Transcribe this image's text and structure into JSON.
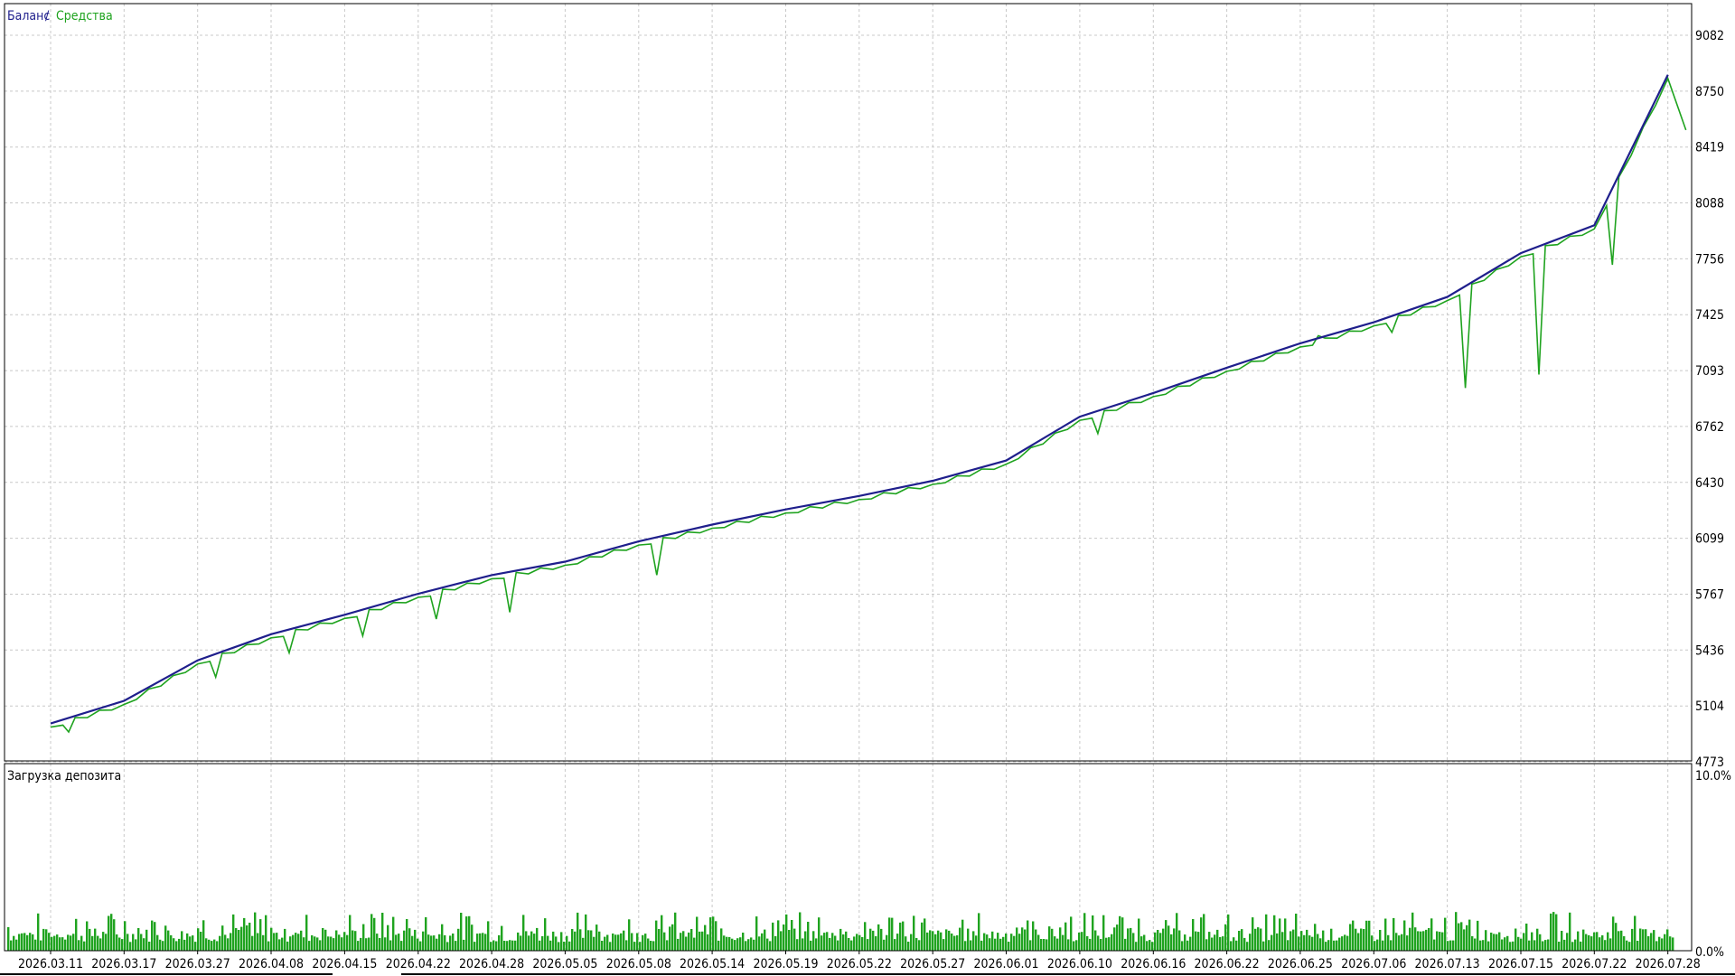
{
  "colors": {
    "background": "#ffffff",
    "grid": "#c8c8c8",
    "frame": "#000000",
    "balance": "#1f1f8c",
    "equity": "#1fa31f",
    "load": "#1fa31f"
  },
  "legend": {
    "balance": "Баланс",
    "separator": "/",
    "equity": "Средства"
  },
  "load_panel": {
    "label": "Загрузка депозита"
  },
  "chart_data": [
    {
      "type": "line",
      "title": "",
      "series": [
        {
          "name": "Баланс",
          "color": "#1f1f8c"
        },
        {
          "name": "Средства",
          "color": "#1fa31f"
        }
      ],
      "x": [
        "2026.03.11",
        "2026.03.17",
        "2026.03.27",
        "2026.04.08",
        "2026.04.15",
        "2026.04.22",
        "2026.04.28",
        "2026.05.05",
        "2026.05.08",
        "2026.05.14",
        "2026.05.19",
        "2026.05.22",
        "2026.05.27",
        "2026.06.01",
        "2026.06.10",
        "2026.06.16",
        "2026.06.22",
        "2026.06.25",
        "2026.07.06",
        "2026.07.13",
        "2026.07.15",
        "2026.07.22",
        "2026.07.28"
      ],
      "balance_points": [
        [
          "2026.03.11",
          5000
        ],
        [
          "2026.03.17",
          5135
        ],
        [
          "2026.03.27",
          5375
        ],
        [
          "2026.04.08",
          5530
        ],
        [
          "2026.04.15",
          5645
        ],
        [
          "2026.04.22",
          5770
        ],
        [
          "2026.04.28",
          5880
        ],
        [
          "2026.05.05",
          5960
        ],
        [
          "2026.05.08",
          6080
        ],
        [
          "2026.05.14",
          6180
        ],
        [
          "2026.05.19",
          6270
        ],
        [
          "2026.05.22",
          6350
        ],
        [
          "2026.05.27",
          6440
        ],
        [
          "2026.06.01",
          6560
        ],
        [
          "2026.06.10",
          6820
        ],
        [
          "2026.06.16",
          6960
        ],
        [
          "2026.06.22",
          7110
        ],
        [
          "2026.06.25",
          7255
        ],
        [
          "2026.07.06",
          7380
        ],
        [
          "2026.07.13",
          7530
        ],
        [
          "2026.07.15",
          7790
        ],
        [
          "2026.07.22",
          7955
        ],
        [
          "2026.07.28",
          8847
        ]
      ],
      "equity_drawdowns": [
        [
          "2026.03.11",
          4950
        ],
        [
          "2026.03.27",
          5275
        ],
        [
          "2026.04.08",
          5420
        ],
        [
          "2026.04.15",
          5520
        ],
        [
          "2026.04.22",
          5620
        ],
        [
          "2026.04.28",
          5660
        ],
        [
          "2026.05.08",
          5880
        ],
        [
          "2026.05.14",
          6180
        ],
        [
          "2026.06.10",
          6720
        ],
        [
          "2026.06.25",
          7300
        ],
        [
          "2026.07.06",
          7320
        ],
        [
          "2026.07.13",
          6990
        ],
        [
          "2026.07.15",
          7070
        ],
        [
          "2026.07.22",
          7720
        ],
        [
          "2026.07.28",
          8520
        ]
      ],
      "y_ticks": [
        9082,
        8750,
        8419,
        8088,
        7756,
        7425,
        7093,
        6762,
        6430,
        6099,
        5767,
        5436,
        5104,
        4773
      ],
      "ylim": [
        4773,
        9082
      ],
      "grid": true
    },
    {
      "type": "bar",
      "title": "Загрузка депозита",
      "series": [
        {
          "name": "Загрузка депозита",
          "color": "#1fa31f"
        }
      ],
      "x_range": [
        "2026.03.11",
        "2026.07.28"
      ],
      "typical_range": [
        0.3,
        2.1
      ],
      "y_ticks": [
        "10.0%",
        "0.0%"
      ],
      "ylim": [
        0,
        10
      ],
      "grid": true
    }
  ]
}
